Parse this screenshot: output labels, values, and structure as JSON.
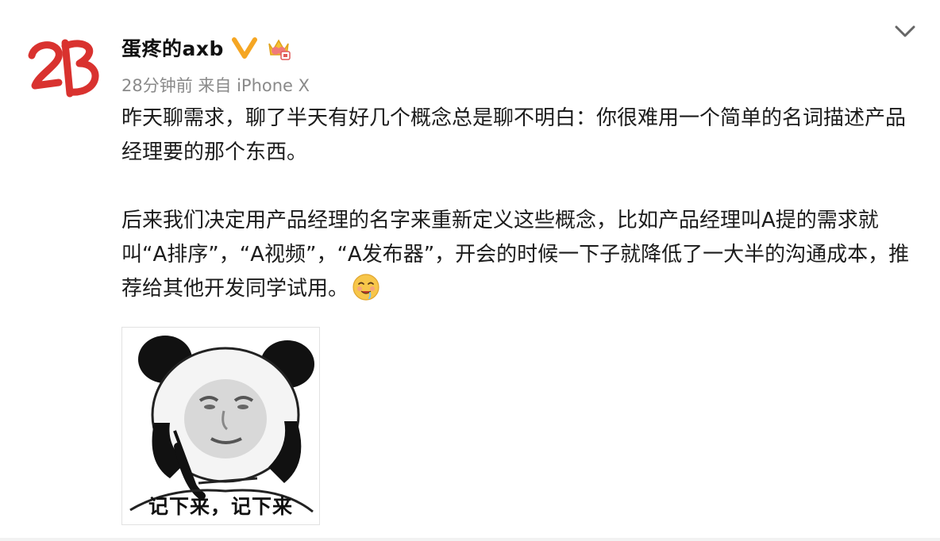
{
  "author": {
    "name": "蛋疼的axb",
    "avatar_text": "2B"
  },
  "meta": {
    "time": "28分钟前",
    "source": "来自 iPhone X"
  },
  "post": {
    "paragraph_1": "昨天聊需求，聊了半天有好几个概念总是聊不明白：你很难用一个简单的名词描述产品经理要的那个东西。",
    "paragraph_2": "后来我们决定用产品经理的名字来重新定义这些概念，比如产品经理叫A提的需求就叫“A排序”，“A视频”，“A发布器”，开会的时候一下子就降低了一大半的沟通成本，推荐给其他开发同学试用。",
    "emoji": "drooling-face-emoji"
  },
  "image": {
    "caption": "记下来，记下来"
  },
  "icons": {
    "verified": "verified-v-icon",
    "vip": "vip-crown-icon",
    "more": "chevron-down-icon"
  },
  "colors": {
    "avatar_red": "#d9322f",
    "verified_gold": "#f5a623",
    "meta_gray": "#8a8a8a"
  }
}
